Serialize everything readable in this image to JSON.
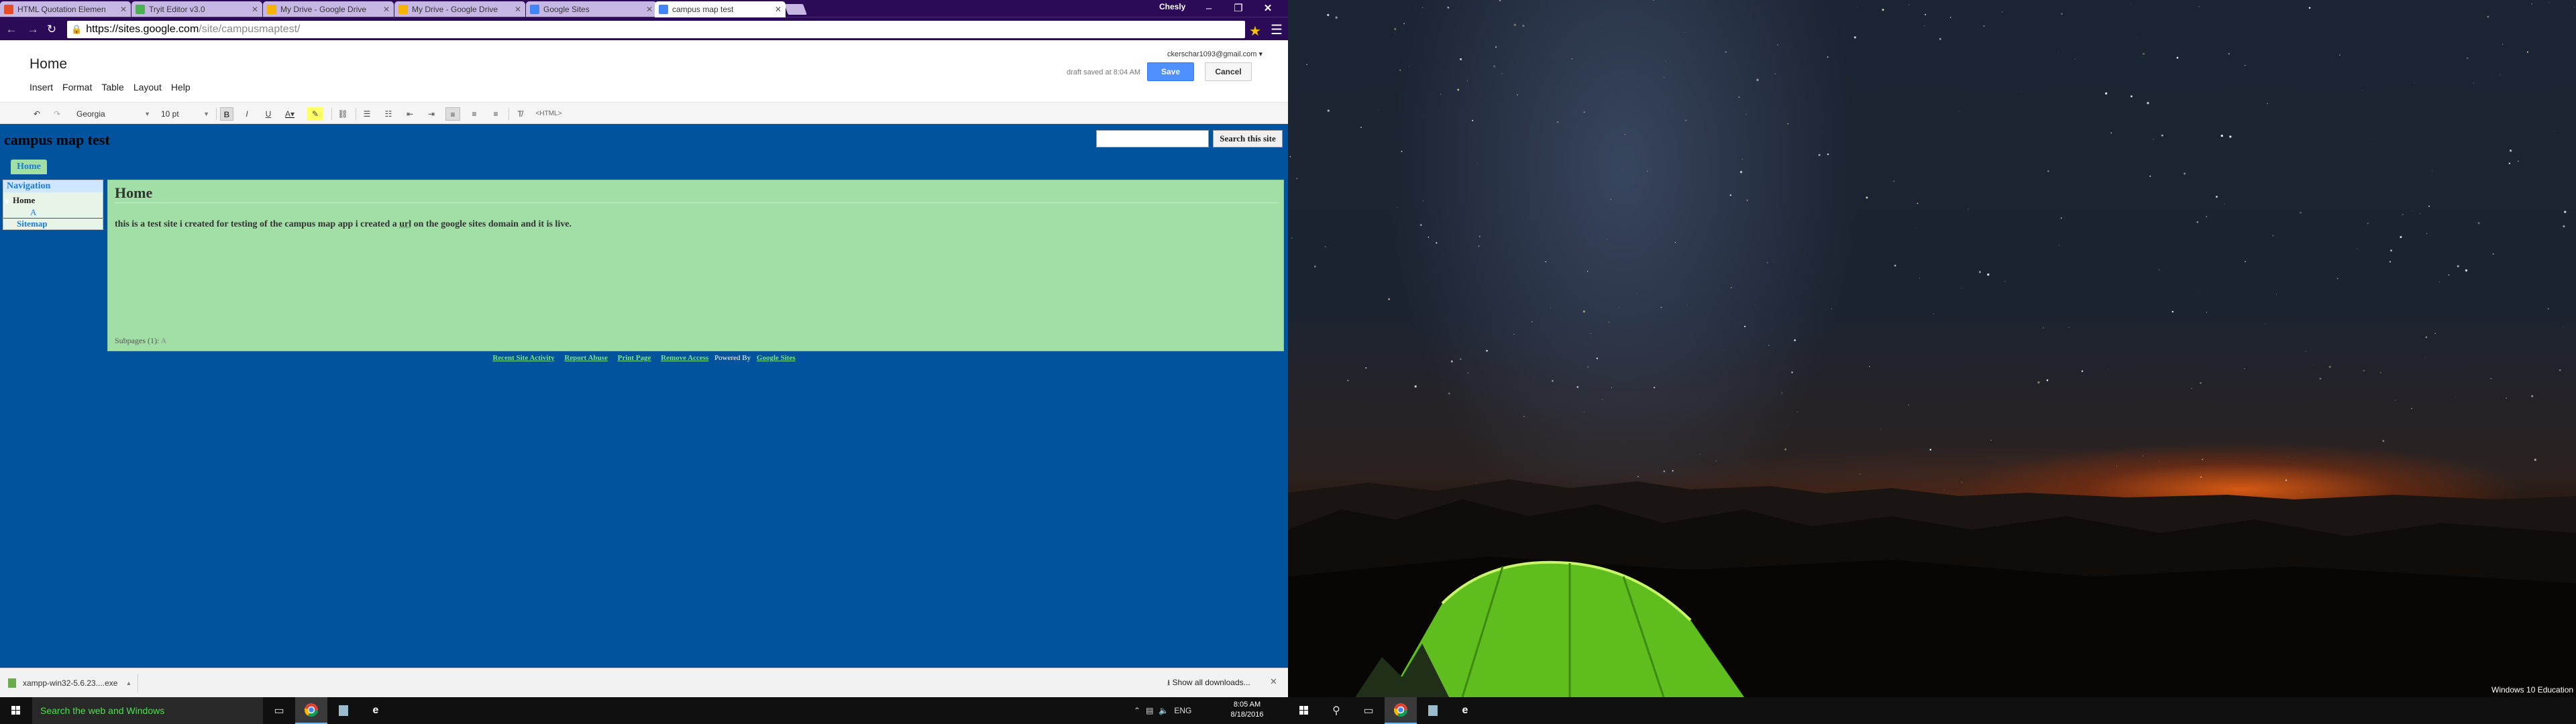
{
  "tabs": [
    {
      "title": "HTML Quotation Elemen",
      "favicon_color": "#e44d26"
    },
    {
      "title": "Tryit Editor v3.0",
      "favicon_color": "#4caf50"
    },
    {
      "title": "My Drive - Google Drive",
      "favicon_color": "#f4b400"
    },
    {
      "title": "My Drive - Google Drive",
      "favicon_color": "#f4b400"
    },
    {
      "title": "Google Sites",
      "favicon_color": "#4285f4"
    },
    {
      "title": "campus map test",
      "favicon_color": "#4285f4",
      "active": true
    }
  ],
  "browser": {
    "user_name": "Chesly",
    "url_host": "https://sites.google.com",
    "url_path": "/site/campusmaptest/"
  },
  "editor": {
    "page_title": "Home",
    "menus": [
      "Insert",
      "Format",
      "Table",
      "Layout",
      "Help"
    ],
    "account": "ckerschar1093@gmail.com",
    "draft_status": "draft saved at 8:04 AM",
    "save_label": "Save",
    "cancel_label": "Cancel",
    "font_family": "Georgia",
    "font_size": "10 pt",
    "html_label": "<HTML>"
  },
  "site": {
    "title": "campus map test",
    "search_button": "Search this site",
    "home_tab": "Home",
    "nav_heading": "Navigation",
    "nav_home": "Home",
    "nav_child": "A",
    "nav_sitemap": "Sitemap",
    "content_title": "Home",
    "content_body_pre": "this is a test site i created for testing of the campus map app i created a ",
    "content_body_url": "url",
    "content_body_post": " on the google sites domain and it is live.",
    "subpages": "Subpages (1):",
    "subpage_item": "A",
    "footer_links": [
      "Recent Site Activity",
      "Report Abuse",
      "Print Page",
      "Remove Access"
    ],
    "footer_powered": "Powered By",
    "footer_google_sites": "Google Sites"
  },
  "downloads": {
    "file_name": "xampp-win32-5.6.23....exe",
    "show_all": "Show all downloads..."
  },
  "taskbar": {
    "search_placeholder": "Search the web and Windows",
    "lang": "ENG",
    "time": "8:05 AM",
    "date": "8/18/2016"
  },
  "desktop": {
    "edition": "Windows 10 Education"
  },
  "colors": {
    "chrome_frame": "#2b0a57",
    "site_background": "#00539c",
    "content_green": "#a1dfa6",
    "link_blue": "#1d7ad7",
    "save_blue": "#4d90fe"
  }
}
